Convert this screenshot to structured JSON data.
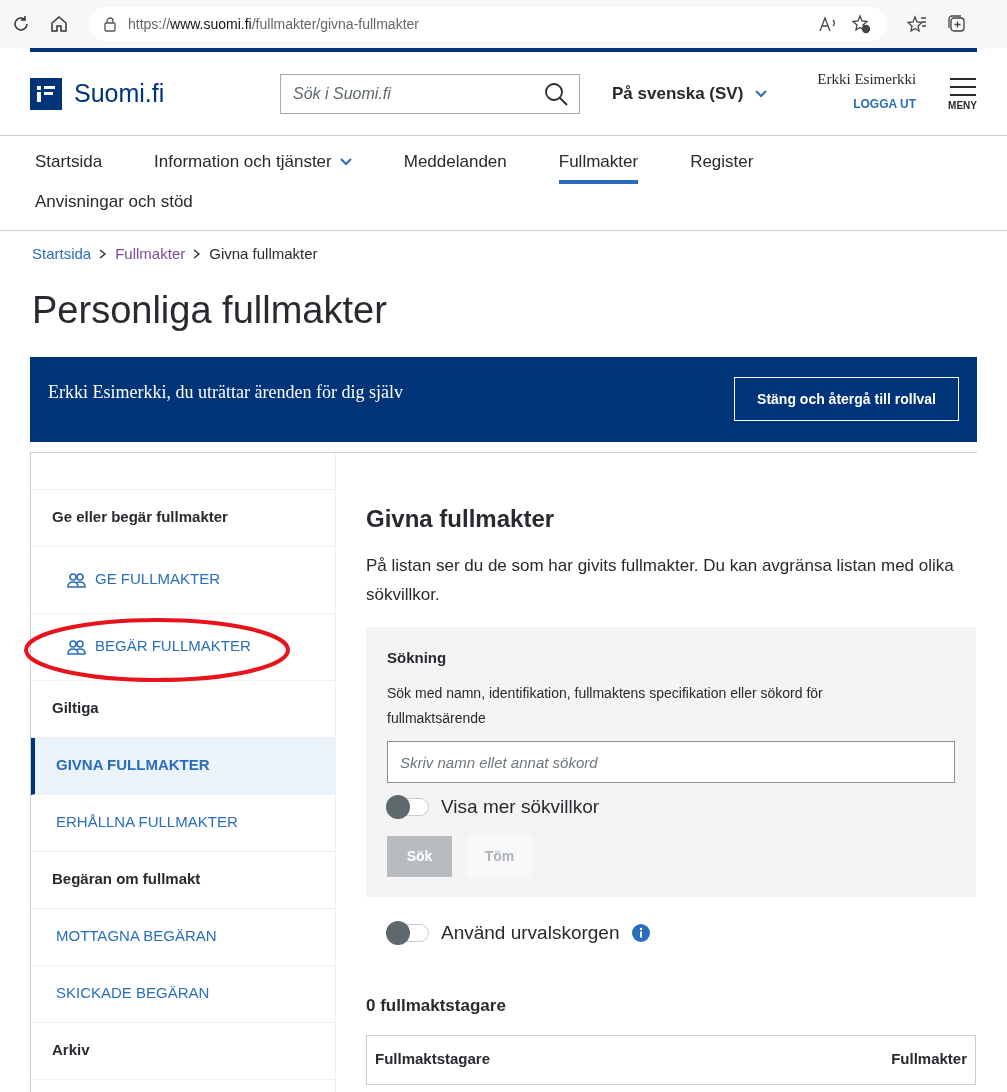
{
  "browser": {
    "url_prefix": "https://",
    "url_host": "www.suomi.fi",
    "url_path": "/fullmakter/givna-fullmakter"
  },
  "header": {
    "logo": "Suomi.fi",
    "search_placeholder": "Sök i Suomi.fi",
    "language": "På svenska (SV)",
    "user": "Erkki Esimerkki",
    "logout": "LOGGA UT",
    "menu": "MENY"
  },
  "nav": [
    {
      "label": "Startsida",
      "selected": false,
      "dropdown": false
    },
    {
      "label": "Information och tjänster",
      "selected": false,
      "dropdown": true
    },
    {
      "label": "Meddelanden",
      "selected": false,
      "dropdown": false
    },
    {
      "label": "Fullmakter",
      "selected": true,
      "dropdown": false
    },
    {
      "label": "Register",
      "selected": false,
      "dropdown": false
    },
    {
      "label": "Anvisningar och stöd",
      "selected": false,
      "dropdown": false
    }
  ],
  "breadcrumbs": [
    "Startsida",
    "Fullmakter",
    "Givna fullmakter"
  ],
  "title": "Personliga fullmakter",
  "banner": {
    "text": "Erkki Esimerkki, du uträttar ärenden för dig själv",
    "button": "Stäng och återgå till rollval"
  },
  "sidebar": [
    {
      "kind": "heading",
      "label": "Ge eller begär fullmakter"
    },
    {
      "kind": "action",
      "label": "GE FULLMAKTER",
      "highlighted": false
    },
    {
      "kind": "action",
      "label": "BEGÄR FULLMAKTER",
      "highlighted": true
    },
    {
      "kind": "heading",
      "label": "Giltiga"
    },
    {
      "kind": "link",
      "label": "GIVNA FULLMAKTER",
      "selected": true
    },
    {
      "kind": "link",
      "label": "ERHÅLLNA FULLMAKTER",
      "selected": false
    },
    {
      "kind": "heading",
      "label": "Begäran om fullmakt"
    },
    {
      "kind": "link",
      "label": "MOTTAGNA BEGÄRAN",
      "selected": false
    },
    {
      "kind": "link",
      "label": "SKICKADE BEGÄRAN",
      "selected": false
    },
    {
      "kind": "heading",
      "label": "Arkiv"
    }
  ],
  "main": {
    "heading": "Givna fullmakter",
    "intro": "På listan ser du de som har givits fullmakter. Du kan avgränsa listan med olika sökvillkor.",
    "search": {
      "title": "Sökning",
      "help": "Sök med namn, identifikation, fullmaktens specifikation eller sökord för fullmaktsärende",
      "placeholder": "Skriv namn ellet annat sökord",
      "toggle": {
        "label": "Visa mer sökvillkor",
        "on": false
      },
      "buttons": [
        {
          "label": "Sök",
          "kind": "primary",
          "disabled": true
        },
        {
          "label": "Töm",
          "kind": "secondary",
          "disabled": true
        }
      ]
    },
    "basket_toggle": {
      "label": "Använd urvalskorgen",
      "on": false,
      "info": true
    },
    "count": "0 fullmaktstagare",
    "table": {
      "columns": [
        "Fullmaktstagare",
        "Fullmakter"
      ]
    }
  }
}
